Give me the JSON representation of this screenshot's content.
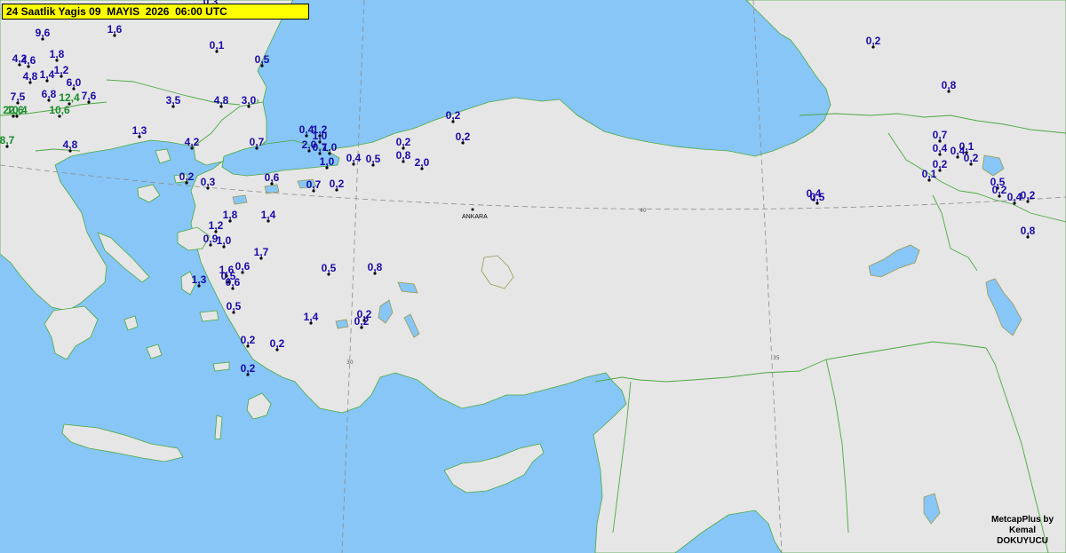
{
  "title": "24 Saatlik Yagis 09  MAYIS  2026  06:00 UTC",
  "credit": {
    "line1": "MetcapPlus by",
    "line2": "Kemal DOKUYUCU"
  },
  "cities": [
    {
      "name": "ANKARA"
    }
  ],
  "grid_labels": [
    "40",
    "30",
    "35"
  ],
  "colors": {
    "sea": "#87c6f7",
    "land": "#e6e6e6",
    "border_green": "#4aa840",
    "lake": "#87c6f7",
    "grid_dash": "#8c8c8c",
    "value_low": "#1a0aa8",
    "value_high": "#1a8c2a",
    "title_bg": "#ffff00"
  },
  "observations": [
    {
      "v": "0,3",
      "c": "b"
    },
    {
      "v": "1,6",
      "c": "b"
    },
    {
      "v": "9,6",
      "c": "b"
    },
    {
      "v": "0,1",
      "c": "b"
    },
    {
      "v": "0,5",
      "c": "b"
    },
    {
      "v": "1,8",
      "c": "b"
    },
    {
      "v": "4,2",
      "c": "b"
    },
    {
      "v": "4,6",
      "c": "b"
    },
    {
      "v": "4,8",
      "c": "b"
    },
    {
      "v": "1,4",
      "c": "b"
    },
    {
      "v": "1,2",
      "c": "b"
    },
    {
      "v": "6,0",
      "c": "b"
    },
    {
      "v": "7,5",
      "c": "b"
    },
    {
      "v": "6,8",
      "c": "b"
    },
    {
      "v": "12,4",
      "c": "g"
    },
    {
      "v": "7,6",
      "c": "b"
    },
    {
      "v": "10,4",
      "c": "g"
    },
    {
      "v": "22,6",
      "c": "g"
    },
    {
      "v": "10,6",
      "c": "g"
    },
    {
      "v": "3,5",
      "c": "b"
    },
    {
      "v": "4,8",
      "c": "b"
    },
    {
      "v": "3,0",
      "c": "b"
    },
    {
      "v": "8,7",
      "c": "g"
    },
    {
      "v": "1,3",
      "c": "b"
    },
    {
      "v": "4,8",
      "c": "b"
    },
    {
      "v": "4,2",
      "c": "b"
    },
    {
      "v": "0,7",
      "c": "b"
    },
    {
      "v": "0,4",
      "c": "b"
    },
    {
      "v": "1,2",
      "c": "b"
    },
    {
      "v": "1,0",
      "c": "b"
    },
    {
      "v": "2,0",
      "c": "b"
    },
    {
      "v": "0,7",
      "c": "b"
    },
    {
      "v": "1,0",
      "c": "b"
    },
    {
      "v": "1,0",
      "c": "b"
    },
    {
      "v": "0,4",
      "c": "b"
    },
    {
      "v": "0,5",
      "c": "b"
    },
    {
      "v": "0,8",
      "c": "b"
    },
    {
      "v": "2,0",
      "c": "b"
    },
    {
      "v": "0,2",
      "c": "b"
    },
    {
      "v": "0,2",
      "c": "b"
    },
    {
      "v": "0,2",
      "c": "b"
    },
    {
      "v": "0,2",
      "c": "b"
    },
    {
      "v": "0,3",
      "c": "b"
    },
    {
      "v": "0,6",
      "c": "b"
    },
    {
      "v": "0,7",
      "c": "b"
    },
    {
      "v": "0,2",
      "c": "b"
    },
    {
      "v": "1,8",
      "c": "b"
    },
    {
      "v": "1,4",
      "c": "b"
    },
    {
      "v": "1,2",
      "c": "b"
    },
    {
      "v": "0,9",
      "c": "b"
    },
    {
      "v": "1,0",
      "c": "b"
    },
    {
      "v": "1,7",
      "c": "b"
    },
    {
      "v": "1,6",
      "c": "b"
    },
    {
      "v": "0,6",
      "c": "b"
    },
    {
      "v": "0,5",
      "c": "b"
    },
    {
      "v": "0,6",
      "c": "b"
    },
    {
      "v": "1,3",
      "c": "b"
    },
    {
      "v": "0,5",
      "c": "b"
    },
    {
      "v": "0,8",
      "c": "b"
    },
    {
      "v": "0,5",
      "c": "b"
    },
    {
      "v": "1,4",
      "c": "b"
    },
    {
      "v": "0,2",
      "c": "b"
    },
    {
      "v": "0,2",
      "c": "b"
    },
    {
      "v": "0,2",
      "c": "b"
    },
    {
      "v": "0,2",
      "c": "b"
    },
    {
      "v": "0,2",
      "c": "b"
    },
    {
      "v": "0,2",
      "c": "b"
    },
    {
      "v": "0,8",
      "c": "b"
    },
    {
      "v": "0,7",
      "c": "b"
    },
    {
      "v": "0,4",
      "c": "b"
    },
    {
      "v": "0,1",
      "c": "b"
    },
    {
      "v": "0,4",
      "c": "b"
    },
    {
      "v": "0,2",
      "c": "b"
    },
    {
      "v": "0,2",
      "c": "b"
    },
    {
      "v": "0,1",
      "c": "b"
    },
    {
      "v": "0,5",
      "c": "b"
    },
    {
      "v": "0,2",
      "c": "b"
    },
    {
      "v": "0,4",
      "c": "b"
    },
    {
      "v": "0,2",
      "c": "b"
    },
    {
      "v": "0,8",
      "c": "b"
    },
    {
      "v": "0,4",
      "c": "b"
    },
    {
      "v": "0,5",
      "c": "b"
    }
  ]
}
